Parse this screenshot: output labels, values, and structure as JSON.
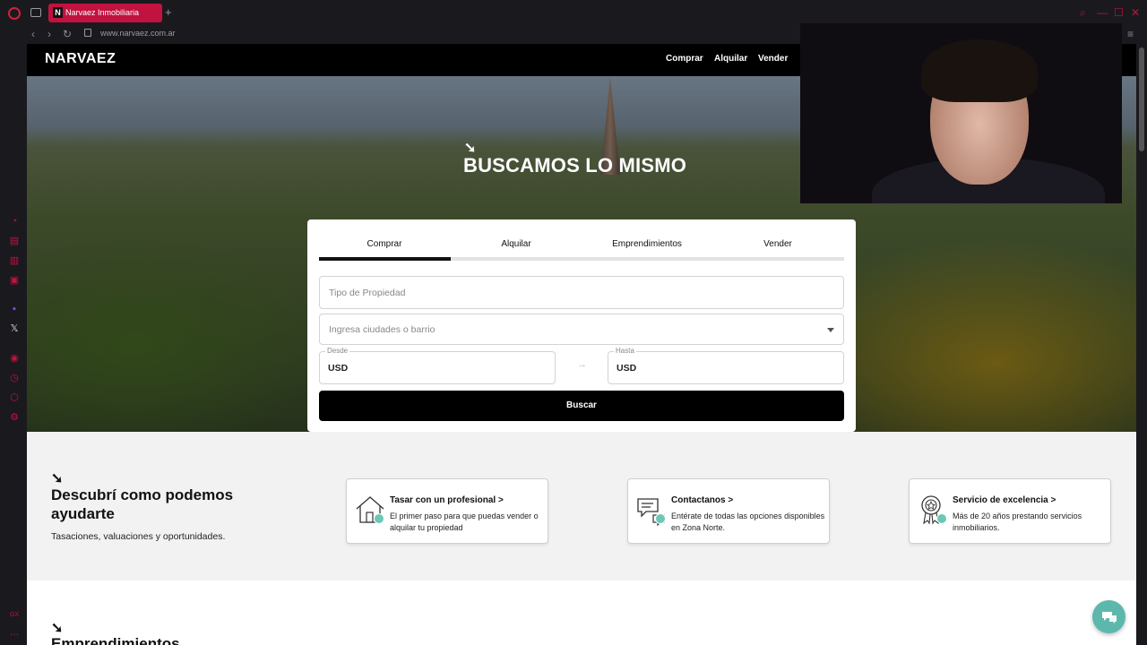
{
  "browser": {
    "tab_title": "Narvaez Inmobiliaria",
    "tab_favicon": "N",
    "new_tab": "+",
    "url": "www.narvaez.com.ar",
    "accent": "#c2123f"
  },
  "site": {
    "logo": "NARVAEZ",
    "nav": [
      "Comprar",
      "Alquilar",
      "Vender"
    ]
  },
  "hero": {
    "arrow": "➘",
    "title": "BUSCAMOS LO MISMO"
  },
  "search": {
    "tabs": [
      "Comprar",
      "Alquilar",
      "Emprendimientos",
      "Vender"
    ],
    "active_tab": "Comprar",
    "property_type_placeholder": "Tipo de Propiedad",
    "location_placeholder": "Ingresa ciudades o barrio",
    "from_label": "Desde",
    "to_label": "Hasta",
    "from_currency": "USD",
    "to_currency": "USD",
    "range_arrow": "→",
    "button": "Buscar"
  },
  "services": {
    "arrow": "➘",
    "title": "Descubrí como podemos ayudarte",
    "subtitle": "Tasaciones, valuaciones y oportunidades.",
    "cards": [
      {
        "icon": "house-icon",
        "title": "Tasar con un profesional >",
        "desc": "El primer paso para que puedas vender o alquilar tu propiedad"
      },
      {
        "icon": "chat-bubbles-icon",
        "title": "Contactanos >",
        "desc": "Entérate de todas las opciones disponibles en Zona Norte."
      },
      {
        "icon": "award-ribbon-icon",
        "title": "Servicio de excelencia >",
        "desc": "Más de 20 años prestando servicios inmobiliarios."
      }
    ]
  },
  "emprendimientos": {
    "arrow": "➘",
    "title": "Emprendimientos"
  },
  "chat": {
    "icon": "chat-icon",
    "color": "#5cb8ad"
  }
}
